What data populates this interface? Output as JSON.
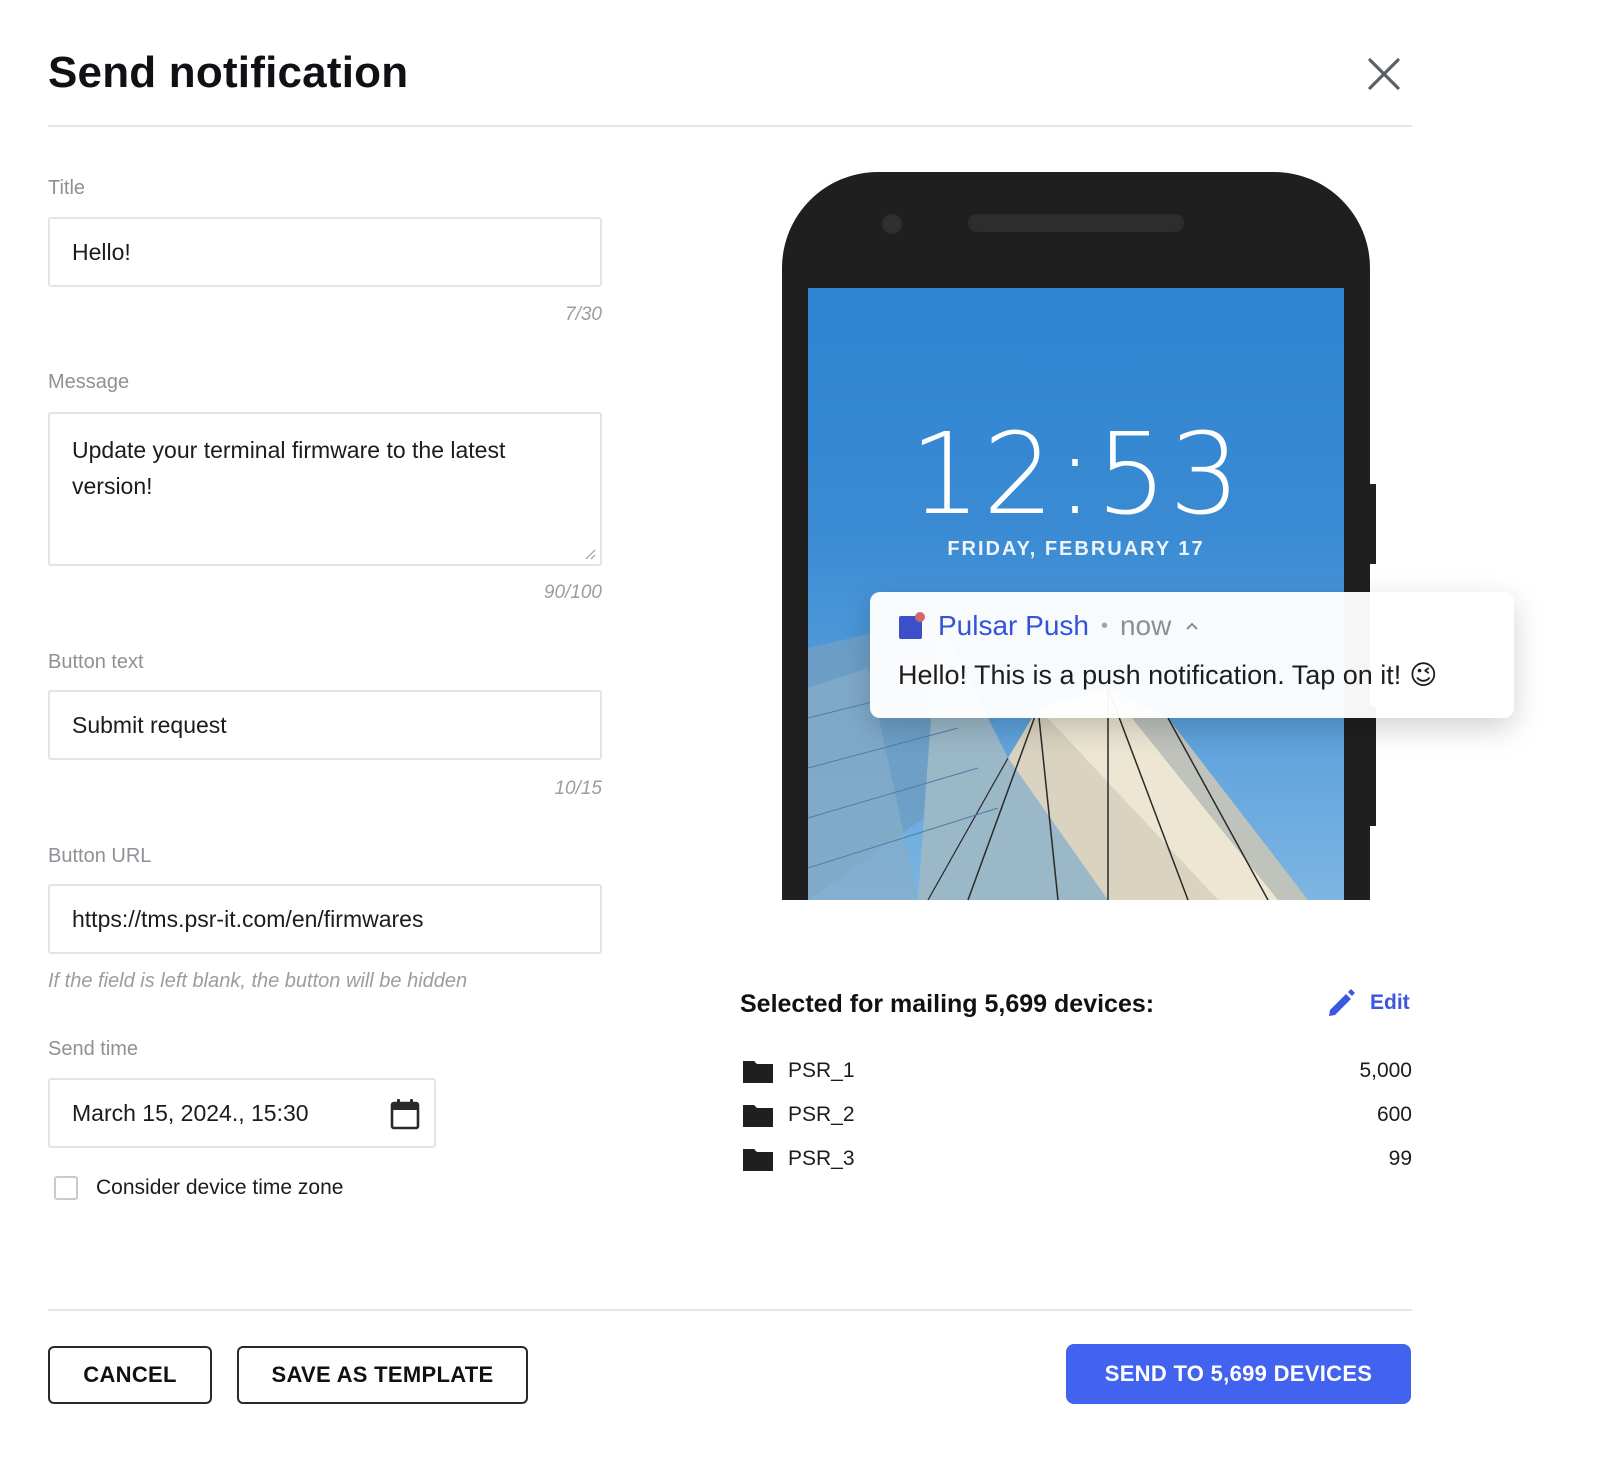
{
  "dialog": {
    "title": "Send notification"
  },
  "form": {
    "title": {
      "label": "Title",
      "value": "Hello!",
      "counter": "7/30"
    },
    "message": {
      "label": "Message",
      "value": "Update your terminal firmware to the latest version!",
      "counter": "90/100"
    },
    "button_text": {
      "label": "Button text",
      "value": "Submit request",
      "counter": "10/15"
    },
    "button_url": {
      "label": "Button URL",
      "value": "https://tms.psr-it.com/en/firmwares",
      "hint": "If the field is left blank, the button will be hidden"
    },
    "send_time": {
      "label": "Send time",
      "value": "March 15, 2024., 15:30"
    },
    "timezone_checkbox": {
      "label": "Consider device time zone",
      "checked": false
    }
  },
  "preview": {
    "clock": "12:53",
    "date": "FRIDAY, FEBRUARY 17",
    "notification": {
      "app_name": "Pulsar Push",
      "separator": "•",
      "time": "now",
      "body": "Hello! This is a push notification. Tap on it!",
      "emoji": "😉"
    }
  },
  "devices": {
    "title": "Selected for mailing 5,699 devices:",
    "edit_label": "Edit",
    "groups": [
      {
        "name": "PSR_1",
        "count": "5,000"
      },
      {
        "name": "PSR_2",
        "count": "600"
      },
      {
        "name": "PSR_3",
        "count": "99"
      }
    ]
  },
  "footer": {
    "cancel_label": "CANCEL",
    "save_template_label": "SAVE AS TEMPLATE",
    "send_label": "SEND TO 5,699 DEVICES"
  },
  "colors": {
    "accent": "#4262f0",
    "link": "#3b57e0",
    "app_name": "#3453d6"
  }
}
